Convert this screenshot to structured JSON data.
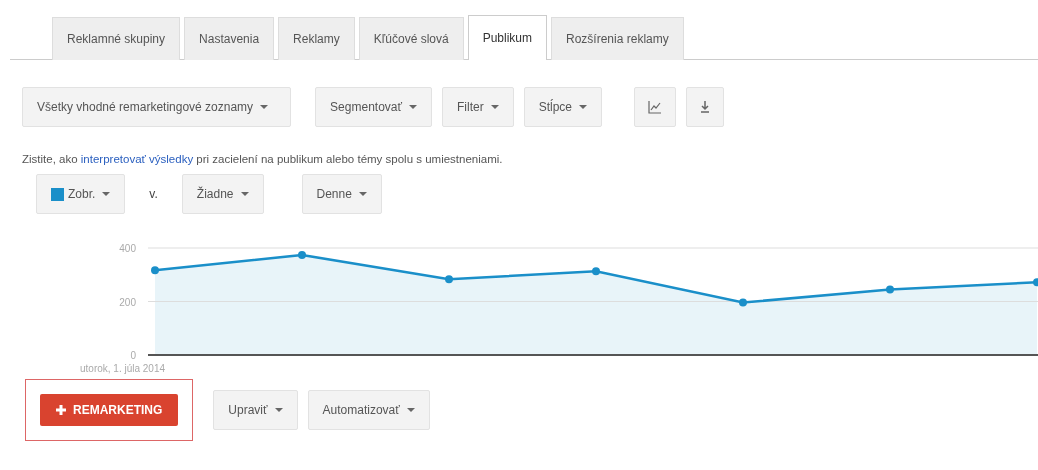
{
  "tabs": [
    {
      "label": "Reklamné skupiny",
      "selected": false
    },
    {
      "label": "Nastavenia",
      "selected": false
    },
    {
      "label": "Reklamy",
      "selected": false
    },
    {
      "label": "Kľúčové slová",
      "selected": false
    },
    {
      "label": "Publikum",
      "selected": true
    },
    {
      "label": "Rozšírenia reklamy",
      "selected": false
    }
  ],
  "toolbar": {
    "list_filter": "Všetky vhodné remarketingové zoznamy",
    "segment": "Segmentovať",
    "filter": "Filter",
    "columns": "Stĺpce"
  },
  "hint": {
    "before": "Zistite, ako ",
    "link": "interpretovať výsledky",
    "after": " pri zacielení na publikum alebo témy spolu s umiestneniami."
  },
  "metrics": {
    "metric": {
      "label": "Zobr.",
      "color": "#1a8fc9"
    },
    "versus": "v.",
    "compare": "Žiadne",
    "period": "Denne"
  },
  "chart": {
    "chart_data": {
      "type": "area",
      "ylim": [
        0,
        400
      ],
      "yticks": [
        {
          "value": 0,
          "label": "0"
        },
        {
          "value": 200,
          "label": "200"
        },
        {
          "value": 400,
          "label": "400"
        }
      ],
      "annotations": [
        "utorok, 1. júla 2014"
      ],
      "series": [
        {
          "color": "#1a8fc9",
          "values": [
            317,
            374,
            283,
            313,
            196,
            245,
            272
          ]
        }
      ]
    }
  },
  "actions": {
    "add": "REMARKETING",
    "edit": "Upraviť",
    "automate": "Automatizovať"
  }
}
